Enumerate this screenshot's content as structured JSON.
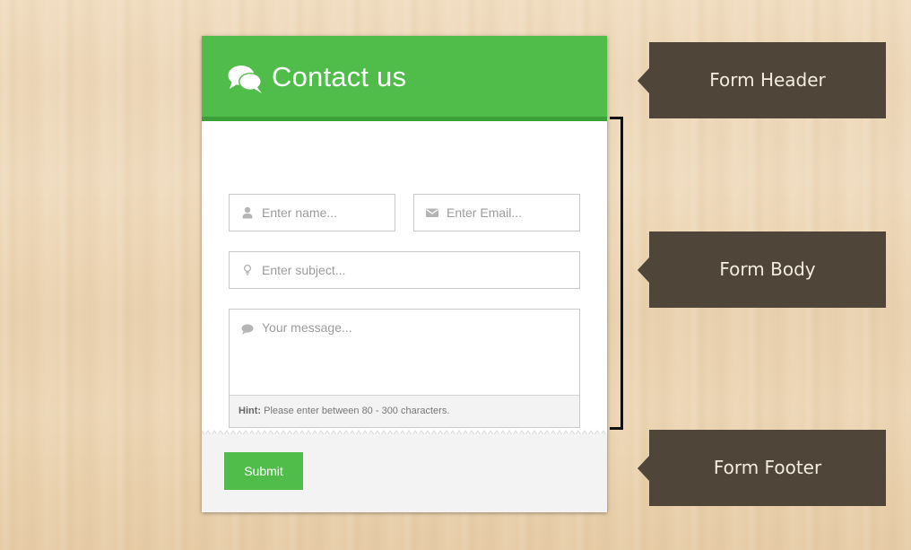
{
  "form": {
    "header": {
      "icon": "comments-icon",
      "title": "Contact us"
    },
    "fields": {
      "name": {
        "icon": "user-icon",
        "placeholder": "Enter name...",
        "value": ""
      },
      "email": {
        "icon": "envelope-icon",
        "placeholder": "Enter Email...",
        "value": ""
      },
      "subject": {
        "icon": "lightbulb-icon",
        "placeholder": "Enter subject...",
        "value": ""
      },
      "message": {
        "icon": "comment-icon",
        "placeholder": "Your message...",
        "value": ""
      }
    },
    "hint": {
      "label": "Hint:",
      "text": " Please enter between 80 - 300 characters."
    },
    "footer": {
      "submit_label": "Submit"
    }
  },
  "annotations": {
    "header": "Form Header",
    "body": "Form Body",
    "footer": "Form Footer"
  },
  "colors": {
    "accent": "#50bd4b",
    "accent_dark": "#3a9f36",
    "label_bg": "#4f4539",
    "background": "#eed7b6"
  }
}
